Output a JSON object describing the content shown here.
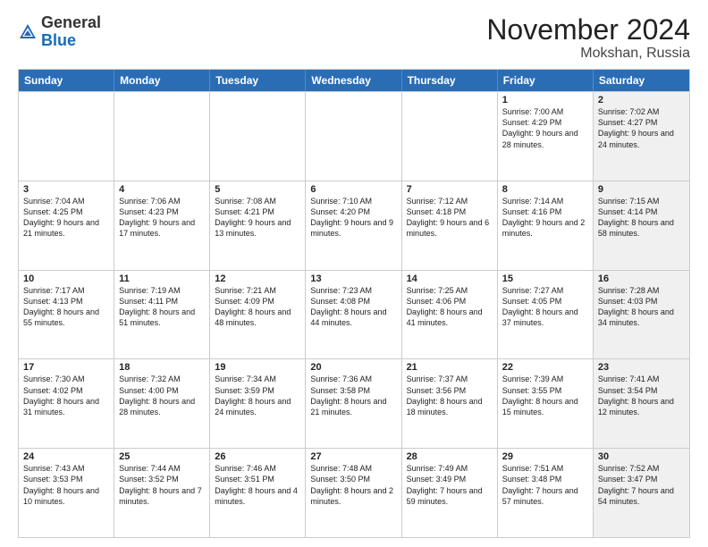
{
  "header": {
    "logo_general": "General",
    "logo_blue": "Blue",
    "month_title": "November 2024",
    "location": "Mokshan, Russia"
  },
  "days_of_week": [
    "Sunday",
    "Monday",
    "Tuesday",
    "Wednesday",
    "Thursday",
    "Friday",
    "Saturday"
  ],
  "weeks": [
    [
      {
        "num": "",
        "info": "",
        "shaded": false
      },
      {
        "num": "",
        "info": "",
        "shaded": false
      },
      {
        "num": "",
        "info": "",
        "shaded": false
      },
      {
        "num": "",
        "info": "",
        "shaded": false
      },
      {
        "num": "",
        "info": "",
        "shaded": false
      },
      {
        "num": "1",
        "info": "Sunrise: 7:00 AM\nSunset: 4:29 PM\nDaylight: 9 hours and 28 minutes.",
        "shaded": false
      },
      {
        "num": "2",
        "info": "Sunrise: 7:02 AM\nSunset: 4:27 PM\nDaylight: 9 hours and 24 minutes.",
        "shaded": true
      }
    ],
    [
      {
        "num": "3",
        "info": "Sunrise: 7:04 AM\nSunset: 4:25 PM\nDaylight: 9 hours and 21 minutes.",
        "shaded": false
      },
      {
        "num": "4",
        "info": "Sunrise: 7:06 AM\nSunset: 4:23 PM\nDaylight: 9 hours and 17 minutes.",
        "shaded": false
      },
      {
        "num": "5",
        "info": "Sunrise: 7:08 AM\nSunset: 4:21 PM\nDaylight: 9 hours and 13 minutes.",
        "shaded": false
      },
      {
        "num": "6",
        "info": "Sunrise: 7:10 AM\nSunset: 4:20 PM\nDaylight: 9 hours and 9 minutes.",
        "shaded": false
      },
      {
        "num": "7",
        "info": "Sunrise: 7:12 AM\nSunset: 4:18 PM\nDaylight: 9 hours and 6 minutes.",
        "shaded": false
      },
      {
        "num": "8",
        "info": "Sunrise: 7:14 AM\nSunset: 4:16 PM\nDaylight: 9 hours and 2 minutes.",
        "shaded": false
      },
      {
        "num": "9",
        "info": "Sunrise: 7:15 AM\nSunset: 4:14 PM\nDaylight: 8 hours and 58 minutes.",
        "shaded": true
      }
    ],
    [
      {
        "num": "10",
        "info": "Sunrise: 7:17 AM\nSunset: 4:13 PM\nDaylight: 8 hours and 55 minutes.",
        "shaded": false
      },
      {
        "num": "11",
        "info": "Sunrise: 7:19 AM\nSunset: 4:11 PM\nDaylight: 8 hours and 51 minutes.",
        "shaded": false
      },
      {
        "num": "12",
        "info": "Sunrise: 7:21 AM\nSunset: 4:09 PM\nDaylight: 8 hours and 48 minutes.",
        "shaded": false
      },
      {
        "num": "13",
        "info": "Sunrise: 7:23 AM\nSunset: 4:08 PM\nDaylight: 8 hours and 44 minutes.",
        "shaded": false
      },
      {
        "num": "14",
        "info": "Sunrise: 7:25 AM\nSunset: 4:06 PM\nDaylight: 8 hours and 41 minutes.",
        "shaded": false
      },
      {
        "num": "15",
        "info": "Sunrise: 7:27 AM\nSunset: 4:05 PM\nDaylight: 8 hours and 37 minutes.",
        "shaded": false
      },
      {
        "num": "16",
        "info": "Sunrise: 7:28 AM\nSunset: 4:03 PM\nDaylight: 8 hours and 34 minutes.",
        "shaded": true
      }
    ],
    [
      {
        "num": "17",
        "info": "Sunrise: 7:30 AM\nSunset: 4:02 PM\nDaylight: 8 hours and 31 minutes.",
        "shaded": false
      },
      {
        "num": "18",
        "info": "Sunrise: 7:32 AM\nSunset: 4:00 PM\nDaylight: 8 hours and 28 minutes.",
        "shaded": false
      },
      {
        "num": "19",
        "info": "Sunrise: 7:34 AM\nSunset: 3:59 PM\nDaylight: 8 hours and 24 minutes.",
        "shaded": false
      },
      {
        "num": "20",
        "info": "Sunrise: 7:36 AM\nSunset: 3:58 PM\nDaylight: 8 hours and 21 minutes.",
        "shaded": false
      },
      {
        "num": "21",
        "info": "Sunrise: 7:37 AM\nSunset: 3:56 PM\nDaylight: 8 hours and 18 minutes.",
        "shaded": false
      },
      {
        "num": "22",
        "info": "Sunrise: 7:39 AM\nSunset: 3:55 PM\nDaylight: 8 hours and 15 minutes.",
        "shaded": false
      },
      {
        "num": "23",
        "info": "Sunrise: 7:41 AM\nSunset: 3:54 PM\nDaylight: 8 hours and 12 minutes.",
        "shaded": true
      }
    ],
    [
      {
        "num": "24",
        "info": "Sunrise: 7:43 AM\nSunset: 3:53 PM\nDaylight: 8 hours and 10 minutes.",
        "shaded": false
      },
      {
        "num": "25",
        "info": "Sunrise: 7:44 AM\nSunset: 3:52 PM\nDaylight: 8 hours and 7 minutes.",
        "shaded": false
      },
      {
        "num": "26",
        "info": "Sunrise: 7:46 AM\nSunset: 3:51 PM\nDaylight: 8 hours and 4 minutes.",
        "shaded": false
      },
      {
        "num": "27",
        "info": "Sunrise: 7:48 AM\nSunset: 3:50 PM\nDaylight: 8 hours and 2 minutes.",
        "shaded": false
      },
      {
        "num": "28",
        "info": "Sunrise: 7:49 AM\nSunset: 3:49 PM\nDaylight: 7 hours and 59 minutes.",
        "shaded": false
      },
      {
        "num": "29",
        "info": "Sunrise: 7:51 AM\nSunset: 3:48 PM\nDaylight: 7 hours and 57 minutes.",
        "shaded": false
      },
      {
        "num": "30",
        "info": "Sunrise: 7:52 AM\nSunset: 3:47 PM\nDaylight: 7 hours and 54 minutes.",
        "shaded": true
      }
    ]
  ]
}
